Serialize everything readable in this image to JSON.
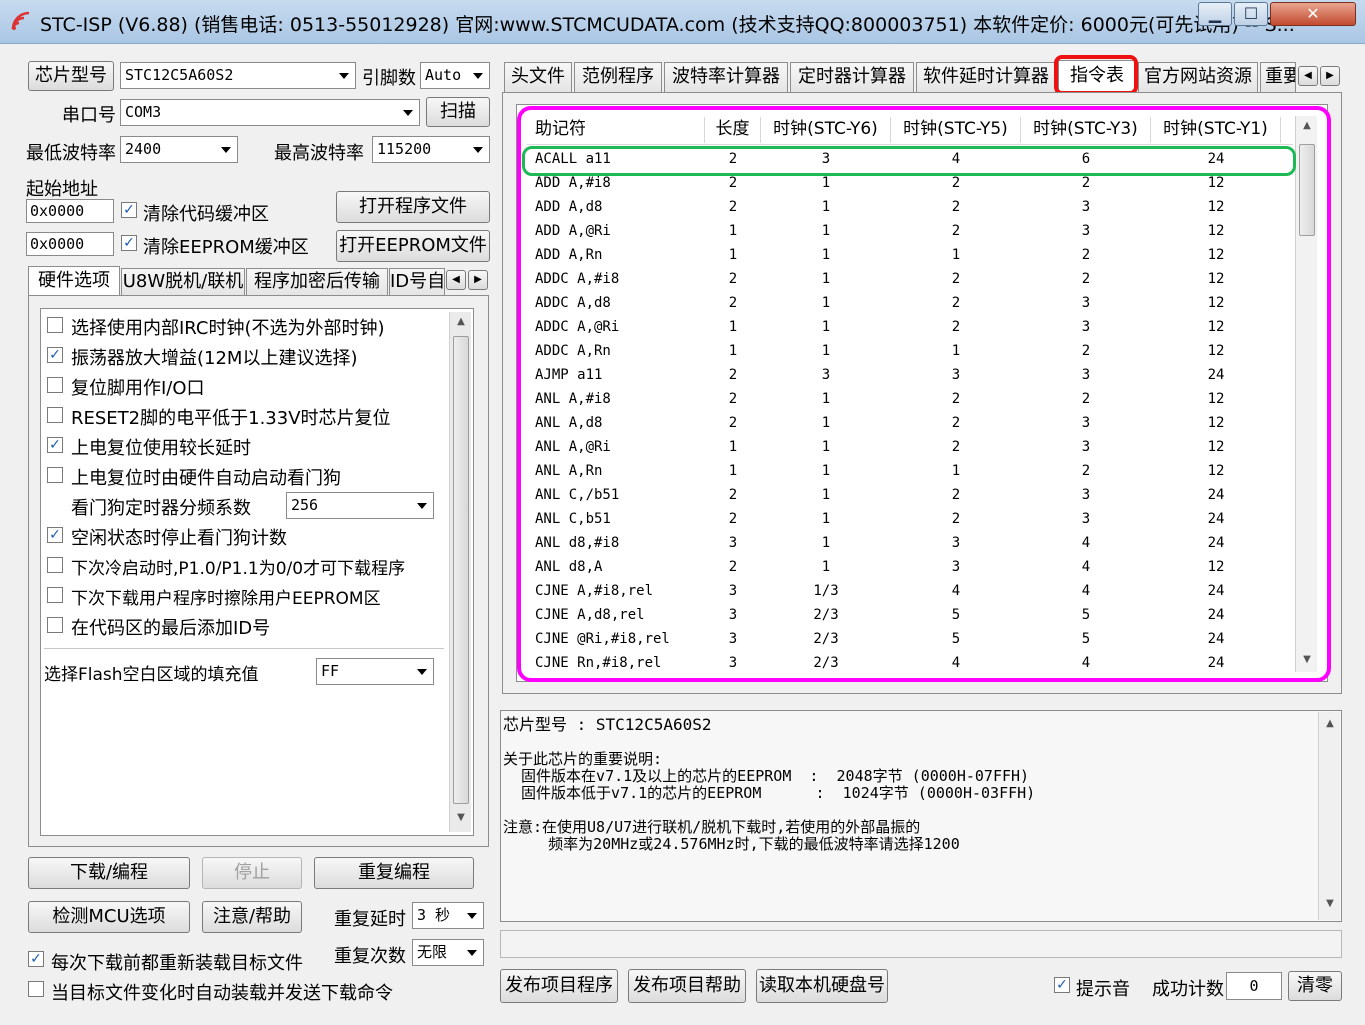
{
  "window": {
    "title": "STC-ISP (V6.88) (销售电话: 0513-55012928) 官网:www.STCMCUDATA.com  (技术支持QQ:800003751) 本软件定价: 6000元(可先试用) -- S...",
    "minimize": "▁",
    "maximize": "☐",
    "close": "✕"
  },
  "left": {
    "chip_btn": "芯片型号",
    "chip_value": "STC12C5A60S2",
    "pins_label": "引脚数",
    "pins_value": "Auto",
    "port_label": "串口号",
    "port_value": "COM3",
    "scan_btn": "扫描",
    "min_baud_label": "最低波特率",
    "min_baud_value": "2400",
    "max_baud_label": "最高波特率",
    "max_baud_value": "115200",
    "start_addr_label": "起始地址",
    "addr1": "0x0000",
    "clear_code": "清除代码缓冲区",
    "open_prog": "打开程序文件",
    "addr2": "0x0000",
    "clear_eeprom": "清除EEPROM缓冲区",
    "open_eeprom": "打开EEPROM文件",
    "tabs": [
      "硬件选项",
      "U8W脱机/联机",
      "程序加密后传输",
      "ID号自"
    ],
    "options": [
      {
        "text": "选择使用内部IRC时钟(不选为外部时钟)",
        "checked": false
      },
      {
        "text": "振荡器放大增益(12M以上建议选择)",
        "checked": true
      },
      {
        "text": "复位脚用作I/O口",
        "checked": false
      },
      {
        "text": "RESET2脚的电平低于1.33V时芯片复位",
        "checked": false
      },
      {
        "text": "上电复位使用较长延时",
        "checked": true
      },
      {
        "text": "上电复位时由硬件自动启动看门狗",
        "checked": false
      }
    ],
    "wdt_label": "看门狗定时器分频系数",
    "wdt_value": "256",
    "options2": [
      {
        "text": "空闲状态时停止看门狗计数",
        "checked": true
      },
      {
        "text": "下次冷启动时,P1.0/P1.1为0/0才可下载程序",
        "checked": false
      },
      {
        "text": "下次下载用户程序时擦除用户EEPROM区",
        "checked": false
      },
      {
        "text": "在代码区的最后添加ID号",
        "checked": false
      }
    ],
    "fill_label": "选择Flash空白区域的填充值",
    "fill_value": "FF",
    "download_btn": "下载/编程",
    "stop_btn": "停止",
    "reprogram_btn": "重复编程",
    "detect_btn": "检测MCU选项",
    "help_btn": "注意/帮助",
    "repeat_delay_label": "重复延时",
    "repeat_delay_value": "3 秒",
    "repeat_count_label": "重复次数",
    "repeat_count_value": "无限",
    "reload_text": "每次下载前都重新装载目标文件",
    "reload_checked": true,
    "auto_text": "当目标文件变化时自动装载并发送下载命令",
    "auto_checked": false
  },
  "right": {
    "tabs": [
      "头文件",
      "范例程序",
      "波特率计算器",
      "定时器计算器",
      "软件延时计算器",
      "指令表",
      "官方网站资源",
      "重要"
    ],
    "table": {
      "headers": [
        "助记符",
        "长度",
        "时钟(STC-Y6)",
        "时钟(STC-Y5)",
        "时钟(STC-Y3)",
        "时钟(STC-Y1)"
      ],
      "rows": [
        [
          "ACALL  a11",
          "2",
          "3",
          "4",
          "6",
          "24"
        ],
        [
          "ADD  A,#i8",
          "2",
          "1",
          "2",
          "2",
          "12"
        ],
        [
          "ADD  A,d8",
          "2",
          "1",
          "2",
          "3",
          "12"
        ],
        [
          "ADD  A,@Ri",
          "1",
          "1",
          "2",
          "3",
          "12"
        ],
        [
          "ADD  A,Rn",
          "1",
          "1",
          "1",
          "2",
          "12"
        ],
        [
          "ADDC  A,#i8",
          "2",
          "1",
          "2",
          "2",
          "12"
        ],
        [
          "ADDC  A,d8",
          "2",
          "1",
          "2",
          "3",
          "12"
        ],
        [
          "ADDC  A,@Ri",
          "1",
          "1",
          "2",
          "3",
          "12"
        ],
        [
          "ADDC  A,Rn",
          "1",
          "1",
          "1",
          "2",
          "12"
        ],
        [
          "AJMP  a11",
          "2",
          "3",
          "3",
          "3",
          "24"
        ],
        [
          "ANL  A,#i8",
          "2",
          "1",
          "2",
          "2",
          "12"
        ],
        [
          "ANL  A,d8",
          "2",
          "1",
          "2",
          "3",
          "12"
        ],
        [
          "ANL  A,@Ri",
          "1",
          "1",
          "2",
          "3",
          "12"
        ],
        [
          "ANL  A,Rn",
          "1",
          "1",
          "1",
          "2",
          "12"
        ],
        [
          "ANL  C,/b51",
          "2",
          "1",
          "2",
          "3",
          "24"
        ],
        [
          "ANL  C,b51",
          "2",
          "1",
          "2",
          "3",
          "24"
        ],
        [
          "ANL  d8,#i8",
          "3",
          "1",
          "3",
          "4",
          "24"
        ],
        [
          "ANL  d8,A",
          "2",
          "1",
          "3",
          "4",
          "12"
        ],
        [
          "CJNE  A,#i8,rel",
          "3",
          "1/3",
          "4",
          "4",
          "24"
        ],
        [
          "CJNE  A,d8,rel",
          "3",
          "2/3",
          "5",
          "5",
          "24"
        ],
        [
          "CJNE  @Ri,#i8,rel",
          "3",
          "2/3",
          "5",
          "5",
          "24"
        ],
        [
          "CJNE  Rn,#i8,rel",
          "3",
          "2/3",
          "4",
          "4",
          "24"
        ]
      ]
    },
    "info_chip_line": "芯片型号 : STC12C5A60S2",
    "info_lines": [
      "关于此芯片的重要说明:",
      "  固件版本在v7.1及以上的芯片的EEPROM  :  2048字节 (0000H-07FFH)",
      "  固件版本低于v7.1的芯片的EEPROM      :  1024字节 (0000H-03FFH)",
      "",
      "注意:在使用U8/U7进行联机/脱机下载时,若使用的外部晶振的",
      "     频率为20MHz或24.576MHz时,下载的最低波特率请选择1200"
    ],
    "publish_prog": "发布项目程序",
    "publish_help": "发布项目帮助",
    "read_disk": "读取本机硬盘号",
    "sound_label": "提示音",
    "sound_checked": true,
    "success_label": "成功计数",
    "success_value": "0",
    "clear_btn": "清零"
  },
  "colors": {
    "magenta_box": "#ff00ff",
    "green_box": "#1db954",
    "red_box": "#ee1111"
  }
}
